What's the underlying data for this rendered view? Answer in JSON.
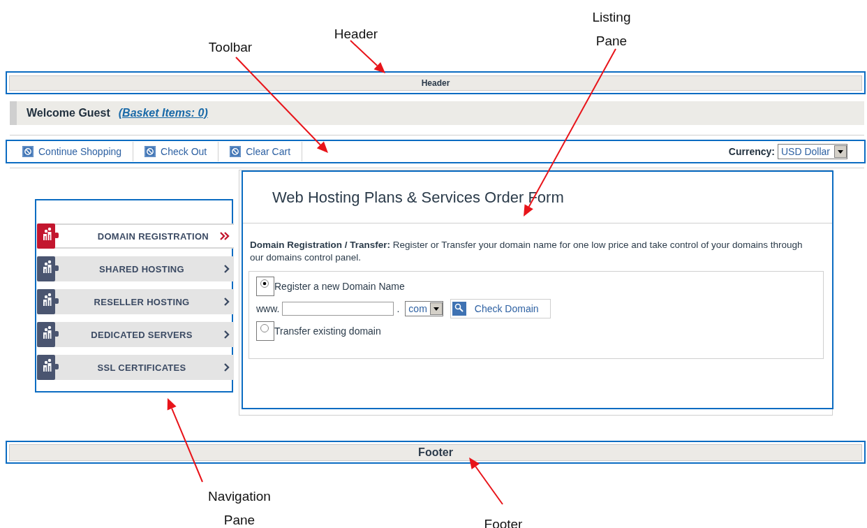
{
  "annotations": [
    {
      "label": "Header"
    },
    {
      "label": "Toolbar"
    },
    {
      "label": "Listing Pane"
    },
    {
      "label": "Navigation Pane"
    },
    {
      "label": "Footer"
    }
  ],
  "header": {
    "title": "Header"
  },
  "welcome": {
    "greeting": "Welcome Guest",
    "basket_link": "(Basket Items: 0)"
  },
  "toolbar": {
    "buttons": [
      "Continue Shopping",
      "Check Out",
      "Clear Cart"
    ],
    "currency_label": "Currency:",
    "currency_value": "USD Dollar"
  },
  "navigation": {
    "items": [
      {
        "label": "DOMAIN REGISTRATION",
        "selected": true
      },
      {
        "label": "SHARED HOSTING",
        "selected": false
      },
      {
        "label": "RESELLER HOSTING",
        "selected": false
      },
      {
        "label": "DEDICATED SERVERS",
        "selected": false
      },
      {
        "label": "SSL CERTIFICATES",
        "selected": false
      }
    ]
  },
  "listing": {
    "title": "Web Hosting Plans & Services Order Form",
    "intro": "**Domain Registration / Transfer:** Register or Transfer your domain name for one low price and take control of your domains through our domains control panel.",
    "options": [
      {
        "label": "Register a new Domain Name",
        "selected": true
      },
      {
        "label": "Transfer existing domain",
        "selected": false
      }
    ],
    "domain_prefix": "www.",
    "separator": ".",
    "tld": "com",
    "check_button": "Check Domain"
  },
  "footer": {
    "title": "Footer"
  }
}
